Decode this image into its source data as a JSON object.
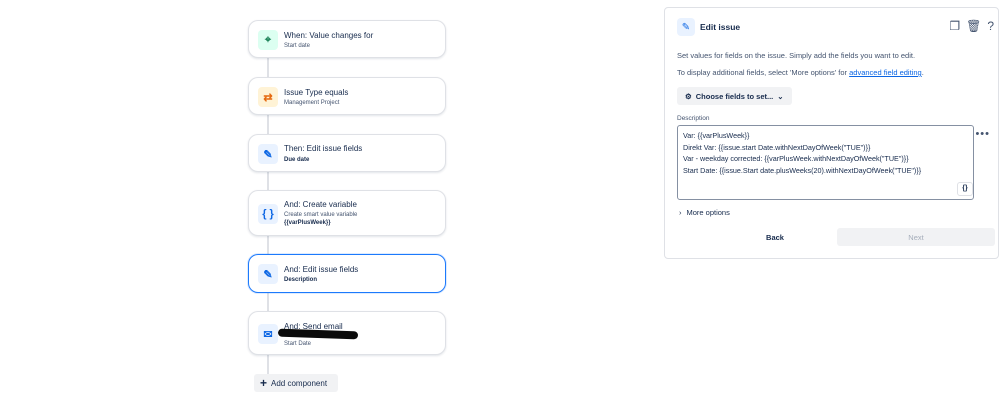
{
  "flow": {
    "cards": [
      {
        "title": "When: Value changes for",
        "subtitle": "Start date",
        "icon": "clock-icon"
      },
      {
        "title": "Issue Type equals",
        "subtitle": "Management Project",
        "icon": "branch-icon"
      },
      {
        "title": "Then: Edit issue fields",
        "subtitle": "Due date",
        "icon": "pencil-icon"
      },
      {
        "title": "And: Create variable",
        "subtitle": "Create smart value variable",
        "subtitle2": "{{varPlusWeek}}",
        "icon": "braces-icon"
      },
      {
        "title": "And: Edit issue fields",
        "subtitle": "Description",
        "icon": "pencil-icon"
      },
      {
        "title": "And: Send email",
        "subtitle": "Start Date",
        "icon": "mail-icon"
      }
    ],
    "add_component": "Add component"
  },
  "panel": {
    "title": "Edit issue",
    "intro": "Set values for fields on the issue. Simply add the fields you want to edit.",
    "more_info_prefix": "To display additional fields, select 'More options' for ",
    "more_info_link": "advanced field editing",
    "more_info_suffix": ".",
    "choose_button": "Choose fields to set...",
    "description_label": "Description",
    "description_lines": [
      "Var: {{varPlusWeek}}",
      "Direkt Var: {{issue.start Date.withNextDayOfWeek(\"TUE\")}}",
      "Var - weekday corrected: {{varPlusWeek.withNextDayOfWeek(\"TUE\")}}",
      "Start Date: {{issue.Start date.plusWeeks(20).withNextDayOfWeek(\"TUE\")}}"
    ],
    "insert_smart_value": "{}",
    "more_options": "More options",
    "back": "Back",
    "next": "Next"
  },
  "colors": {
    "accent": "#1d7afc",
    "link": "#0c66e4"
  }
}
